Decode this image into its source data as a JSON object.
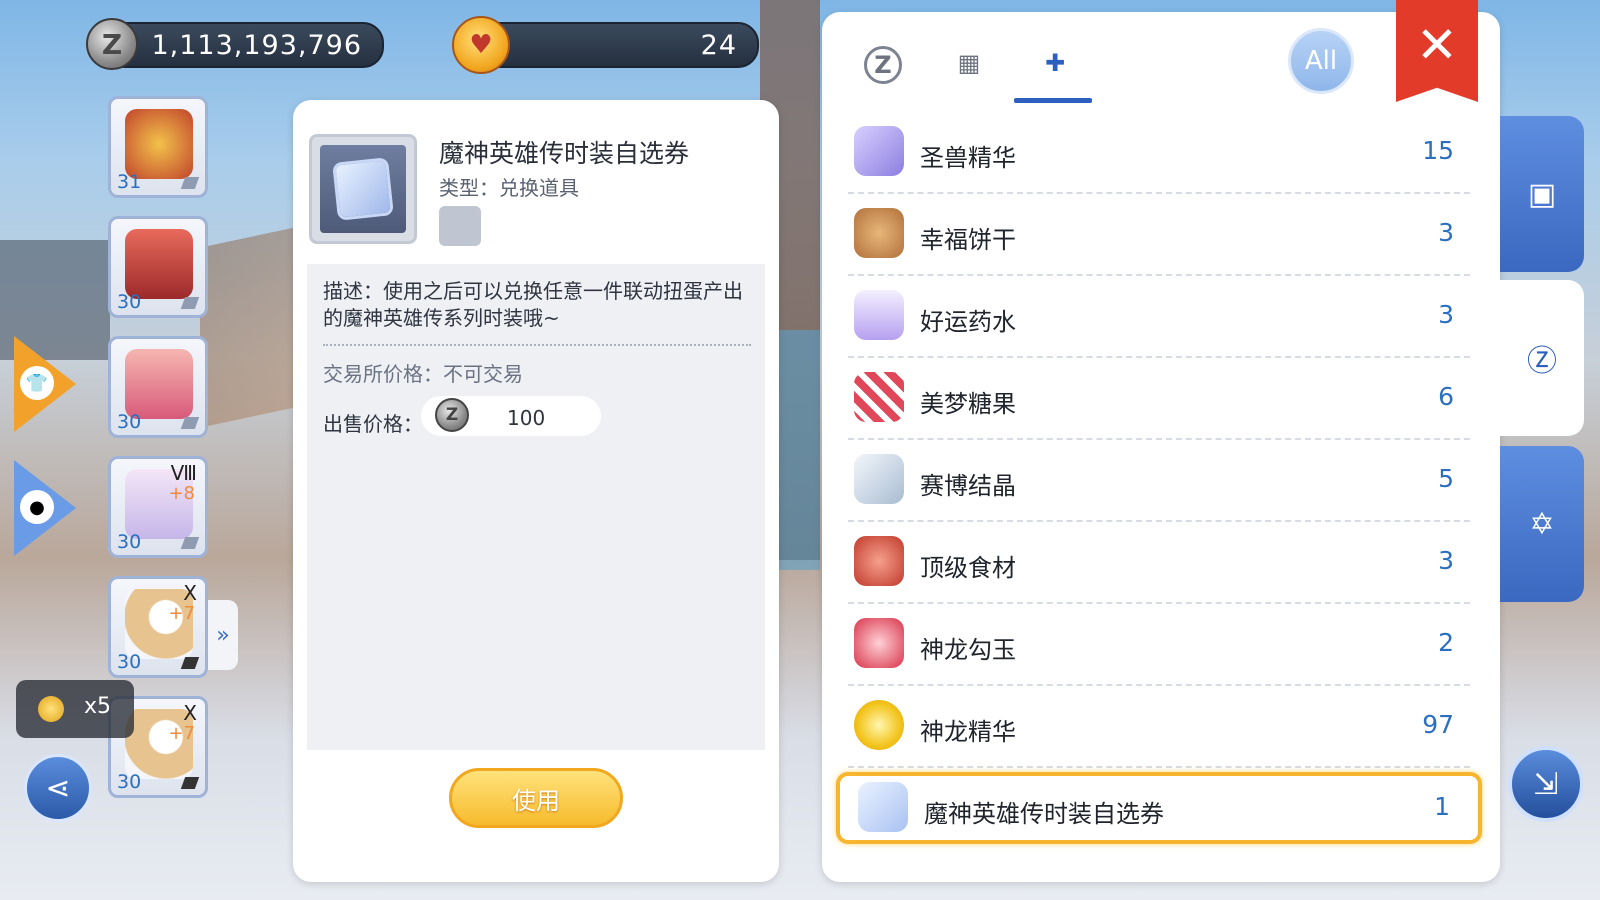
{
  "currency": {
    "zeny": "1,113,193,796",
    "bottle": "24"
  },
  "equipment": [
    {
      "level": "31",
      "rank": "",
      "plus": ""
    },
    {
      "level": "30",
      "rank": "",
      "plus": ""
    },
    {
      "level": "30",
      "rank": "",
      "plus": ""
    },
    {
      "level": "30",
      "rank": "Ⅷ",
      "plus": "+8"
    },
    {
      "level": "30",
      "rank": "X",
      "plus": "+7"
    },
    {
      "level": "30",
      "rank": "X",
      "plus": "+7"
    }
  ],
  "multiplier": "x5",
  "detail": {
    "name": "魔神英雄传时装自选券",
    "type": "类型：兑换道具",
    "description": "描述：使用之后可以兑换任意一件联动扭蛋产出的魔神英雄传系列时装哦~",
    "trade_price": "交易所价格：不可交易",
    "sell_label": "出售价格：",
    "sell_value": "100",
    "use_label": "使用"
  },
  "inventory": {
    "all_label": "All",
    "items": [
      {
        "name": "圣兽精华",
        "count": "15",
        "color": "#8c7ee0"
      },
      {
        "name": "幸福饼干",
        "count": "3",
        "color": "#c98a4e"
      },
      {
        "name": "好运药水",
        "count": "3",
        "color": "#b6a0f0"
      },
      {
        "name": "美梦糖果",
        "count": "6",
        "color": "#e0485a"
      },
      {
        "name": "赛博结晶",
        "count": "5",
        "color": "#c7d6e6"
      },
      {
        "name": "顶级食材",
        "count": "3",
        "color": "#e25a4a"
      },
      {
        "name": "神龙勾玉",
        "count": "2",
        "color": "#d8344a"
      },
      {
        "name": "神龙精华",
        "count": "97",
        "color": "#f2c41c"
      },
      {
        "name": "魔神英雄传时装自选券",
        "count": "1",
        "color": "#a9c2f2"
      }
    ]
  },
  "colors": {
    "accent": "#2d5fbf",
    "count_blue": "#2b6fbf",
    "close_red": "#e23b2a",
    "use_gold": "#f6bb2c",
    "selected_border": "#f6b52c"
  }
}
